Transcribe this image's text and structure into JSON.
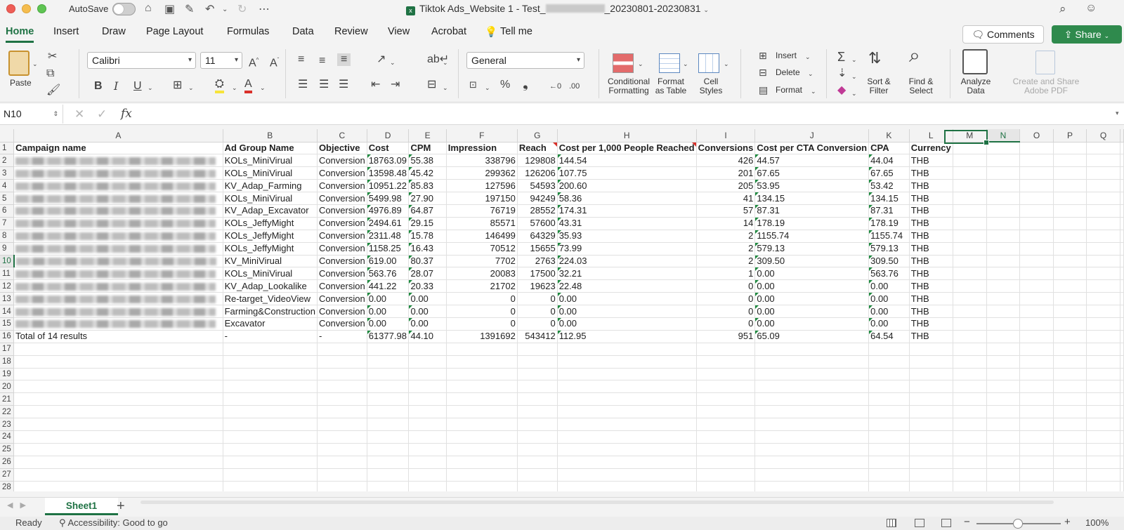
{
  "window": {
    "autosave_label": "AutoSave",
    "title_prefix": "Tiktok Ads_Website 1 - Test_",
    "title_suffix": "_20230801-20230831"
  },
  "ribbon_tabs": [
    "Home",
    "Insert",
    "Draw",
    "Page Layout",
    "Formulas",
    "Data",
    "Review",
    "View",
    "Acrobat"
  ],
  "tell_me": "Tell me",
  "buttons": {
    "comments": "Comments",
    "share": "Share"
  },
  "ribbon": {
    "paste": "Paste",
    "font_name": "Calibri",
    "font_size": "11",
    "number_format": "General",
    "conditional_formatting": "Conditional\nFormatting",
    "format_as_table": "Format\nas Table",
    "cell_styles": "Cell\nStyles",
    "insert": "Insert",
    "delete": "Delete",
    "format": "Format",
    "sort_filter": "Sort &\nFilter",
    "find_select": "Find &\nSelect",
    "analyze_data": "Analyze\nData",
    "create_share_pdf": "Create and Share\nAdobe PDF"
  },
  "formula_bar": {
    "name_box": "N10",
    "fx": "fx",
    "content": ""
  },
  "columns": [
    "A",
    "B",
    "C",
    "D",
    "E",
    "F",
    "G",
    "H",
    "I",
    "J",
    "K",
    "L",
    "M",
    "N",
    "O",
    "P",
    "Q"
  ],
  "headers": [
    "Campaign name",
    "Ad Group Name",
    "Objective",
    "Cost",
    "CPM",
    "Impression",
    "Reach",
    "Cost per 1,000 People Reached",
    "Conversions",
    "Cost per CTA Conversion",
    "CPA",
    "Currency"
  ],
  "rows": [
    [
      "",
      "KOLs_MiniVirual",
      "Conversion",
      "18763.09",
      "55.38",
      "338796",
      "129808",
      "144.54",
      "426",
      "44.57",
      "44.04",
      "THB"
    ],
    [
      "",
      "KOLs_MiniVirual",
      "Conversion",
      "13598.48",
      "45.42",
      "299362",
      "126206",
      "107.75",
      "201",
      "67.65",
      "67.65",
      "THB"
    ],
    [
      "",
      "KV_Adap_Farming",
      "Conversion",
      "10951.22",
      "85.83",
      "127596",
      "54593",
      "200.60",
      "205",
      "53.95",
      "53.42",
      "THB"
    ],
    [
      "",
      "KOLs_MiniVirual",
      "Conversion",
      "5499.98",
      "27.90",
      "197150",
      "94249",
      "58.36",
      "41",
      "134.15",
      "134.15",
      "THB"
    ],
    [
      "",
      "KV_Adap_Excavator",
      "Conversion",
      "4976.89",
      "64.87",
      "76719",
      "28552",
      "174.31",
      "57",
      "87.31",
      "87.31",
      "THB"
    ],
    [
      "",
      "KOLs_JeffyMight",
      "Conversion",
      "2494.61",
      "29.15",
      "85571",
      "57600",
      "43.31",
      "14",
      "178.19",
      "178.19",
      "THB"
    ],
    [
      "",
      "KOLs_JeffyMight",
      "Conversion",
      "2311.48",
      "15.78",
      "146499",
      "64329",
      "35.93",
      "2",
      "1155.74",
      "1155.74",
      "THB"
    ],
    [
      "",
      "KOLs_JeffyMight",
      "Conversion",
      "1158.25",
      "16.43",
      "70512",
      "15655",
      "73.99",
      "2",
      "579.13",
      "579.13",
      "THB"
    ],
    [
      "",
      "KV_MiniVirual",
      "Conversion",
      "619.00",
      "80.37",
      "7702",
      "2763",
      "224.03",
      "2",
      "309.50",
      "309.50",
      "THB"
    ],
    [
      "",
      "KOLs_MiniVirual",
      "Conversion",
      "563.76",
      "28.07",
      "20083",
      "17500",
      "32.21",
      "1",
      "0.00",
      "563.76",
      "THB"
    ],
    [
      "",
      "KV_Adap_Lookalike",
      "Conversion",
      "441.22",
      "20.33",
      "21702",
      "19623",
      "22.48",
      "0",
      "0.00",
      "0.00",
      "THB"
    ],
    [
      "",
      "Re-target_VideoView",
      "Conversion",
      "0.00",
      "0.00",
      "0",
      "0",
      "0.00",
      "0",
      "0.00",
      "0.00",
      "THB"
    ],
    [
      "",
      "Farming&Construction",
      "Conversion",
      "0.00",
      "0.00",
      "0",
      "0",
      "0.00",
      "0",
      "0.00",
      "0.00",
      "THB"
    ],
    [
      "",
      "Excavator",
      "Conversion",
      "0.00",
      "0.00",
      "0",
      "0",
      "0.00",
      "0",
      "0.00",
      "0.00",
      "THB"
    ],
    [
      "Total of 14 results",
      "-",
      "-",
      "61377.98",
      "44.10",
      "1391692",
      "543412",
      "112.95",
      "951",
      "65.09",
      "64.54",
      "THB"
    ]
  ],
  "sheet_tab": "Sheet1",
  "status": {
    "ready": "Ready",
    "accessibility": "Accessibility: Good to go",
    "zoom": "100%"
  }
}
